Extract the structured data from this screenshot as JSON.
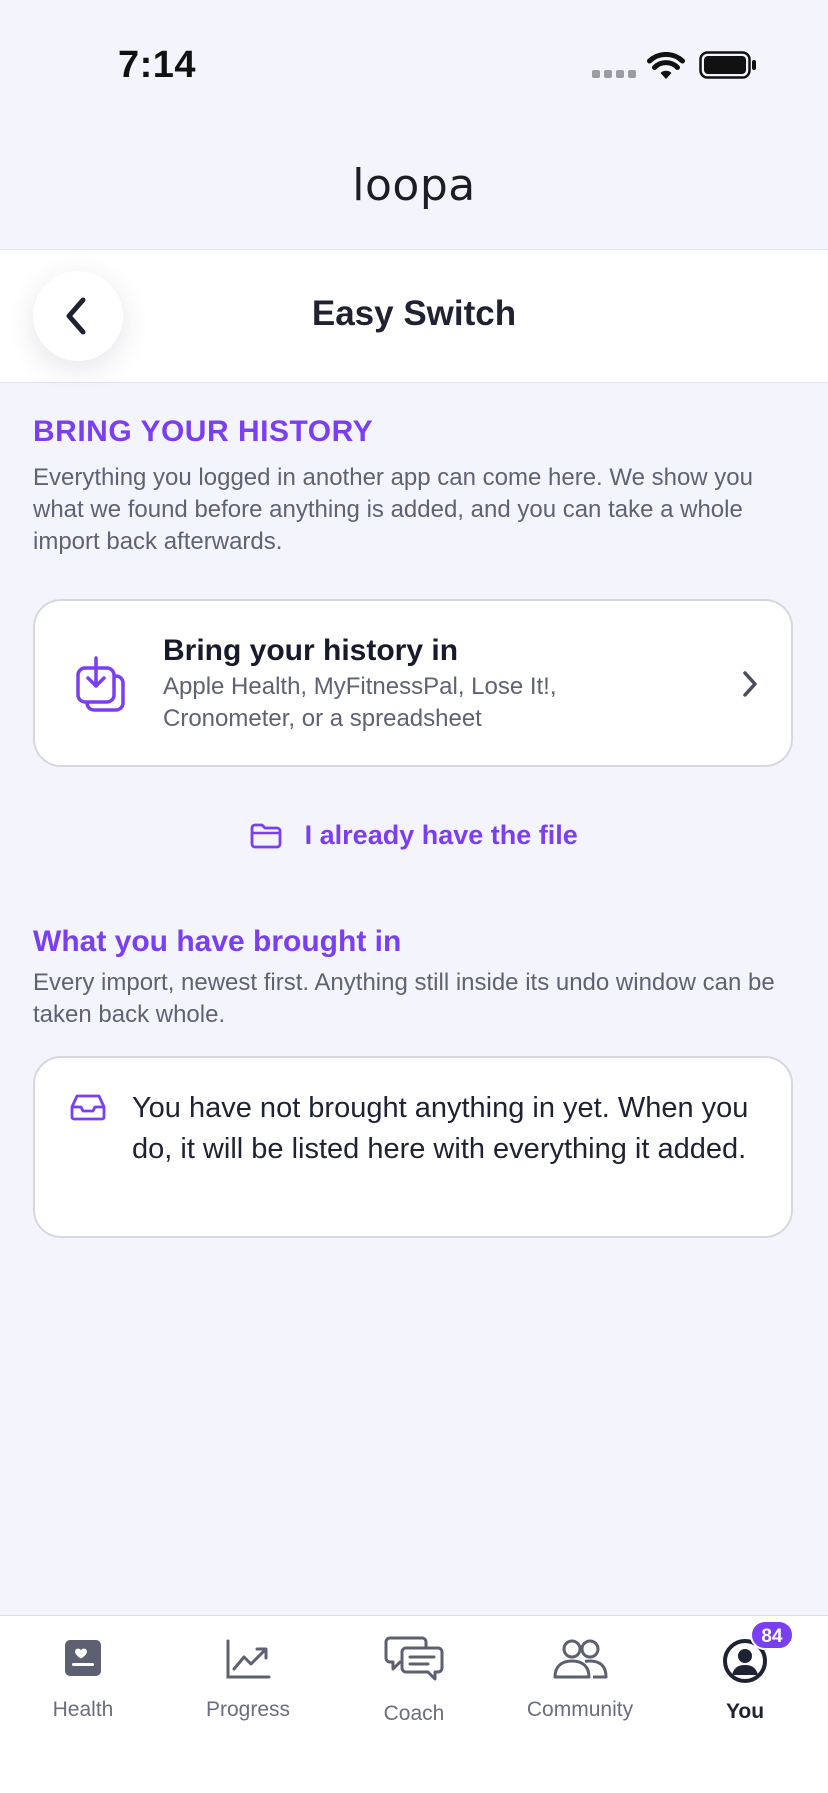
{
  "status_bar": {
    "time": "7:14",
    "icons": [
      "signal-icon",
      "wifi-icon",
      "battery-icon"
    ]
  },
  "header": {
    "logo_text": "loopa"
  },
  "nav": {
    "title": "Easy Switch",
    "back_icon": "chevron-left-icon"
  },
  "history_section": {
    "title": "BRING YOUR HISTORY",
    "description": "Everything you logged in another app can come here. We show you what we found before anything is added, and you can take a whole import back afterwards."
  },
  "import_card": {
    "icon": "download-tray-icon",
    "title": "Bring your history in",
    "subtitle": "Apple Health, MyFitnessPal, Lose It!, Cronometer, or a spreadsheet",
    "chevron_icon": "chevron-right-icon"
  },
  "file_link": {
    "icon": "folder-icon",
    "label": "I already have the file"
  },
  "brought_section": {
    "title": "What you have brought in",
    "description": "Every import, newest first. Anything still inside its undo window can be taken back whole."
  },
  "empty_state": {
    "icon": "inbox-icon",
    "text": "You have not brought anything in yet. When you do, it will be listed here with everything it added."
  },
  "tab_bar": {
    "tabs": [
      {
        "label": "Health",
        "icon": "health-card-icon"
      },
      {
        "label": "Progress",
        "icon": "trend-chart-icon"
      },
      {
        "label": "Coach",
        "icon": "chat-bubbles-icon"
      },
      {
        "label": "Community",
        "icon": "people-icon"
      },
      {
        "label": "You",
        "icon": "user-circle-icon",
        "active": true
      }
    ],
    "you_badge": "84"
  },
  "colors": {
    "accent": "#7B3FF2",
    "background": "#F4F5FC",
    "card": "#FFFFFF",
    "text_primary": "#1E2233",
    "text_secondary": "#5E6273"
  }
}
